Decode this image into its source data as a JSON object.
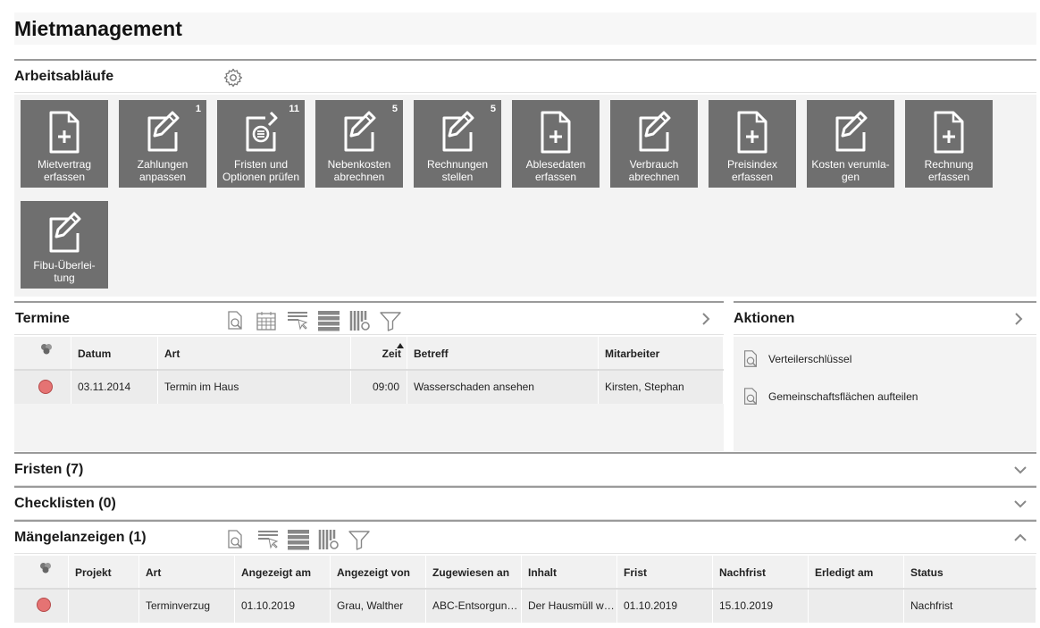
{
  "page": {
    "title": "Mietmanagement"
  },
  "workflows": {
    "title": "Arbeitsabläufe",
    "tiles": [
      {
        "label1": "Mietvertrag",
        "label2": "erfassen",
        "badge": "",
        "icon": "doc-plus-icon"
      },
      {
        "label1": "Zahlungen",
        "label2": "anpassen",
        "badge": "1",
        "icon": "edit-icon"
      },
      {
        "label1": "Fristen und",
        "label2": "Optionen prüfen",
        "badge": "11",
        "icon": "edit-list-icon"
      },
      {
        "label1": "Nebenkosten",
        "label2": "abrechnen",
        "badge": "5",
        "icon": "edit-icon"
      },
      {
        "label1": "Rechnungen",
        "label2": "stellen",
        "badge": "5",
        "icon": "edit-icon"
      },
      {
        "label1": "Ablesedaten",
        "label2": "erfassen",
        "badge": "",
        "icon": "doc-plus-icon"
      },
      {
        "label1": "Verbrauch",
        "label2": "abrechnen",
        "badge": "",
        "icon": "edit-icon"
      },
      {
        "label1": "Preisindex",
        "label2": "erfassen",
        "badge": "",
        "icon": "doc-plus-icon"
      },
      {
        "label1": "Kosten verumla-",
        "label2": "gen",
        "badge": "",
        "icon": "edit-icon"
      },
      {
        "label1": "Rechnung",
        "label2": "erfassen",
        "badge": "",
        "icon": "doc-plus-icon"
      },
      {
        "label1": "Fibu-Überlei-",
        "label2": "tung",
        "badge": "",
        "icon": "edit-icon"
      }
    ]
  },
  "termine": {
    "title": "Termine",
    "columns": [
      "Datum",
      "Art",
      "Zeit",
      "Betreff",
      "Mitarbeiter"
    ],
    "rows": [
      {
        "datum": "03.11.2014",
        "art": "Termin im Haus",
        "zeit": "09:00",
        "betreff": "Wasserschaden ansehen",
        "mitarbeiter": "Kirsten, Stephan"
      }
    ]
  },
  "aktionen": {
    "title": "Aktionen",
    "items": [
      "Verteilerschlüssel",
      "Gemeinschaftsflächen aufteilen"
    ]
  },
  "fristen": {
    "title": "Fristen (7)"
  },
  "checklisten": {
    "title": "Checklisten (0)"
  },
  "maengel": {
    "title": "Mängelanzeigen (1)",
    "columns": [
      "Projekt",
      "Art",
      "Angezeigt am",
      "Angezeigt von",
      "Zugewiesen an",
      "Inhalt",
      "Frist",
      "Nachfrist",
      "Erledigt am",
      "Status"
    ],
    "rows": [
      {
        "projekt": "",
        "art": "Terminverzug",
        "angezeigt_am": "01.10.2019",
        "angezeigt_von": "Grau, Walther",
        "zugewiesen_an": "ABC-Entsorgungs GmbH",
        "inhalt": "Der Hausmüll wurde nicht abgeholt",
        "frist": "01.10.2019",
        "nachfrist": "15.10.2019",
        "erledigt_am": "",
        "status": "Nachfrist"
      }
    ]
  },
  "colors": {
    "tile_bg": "#6f6f6f",
    "status_red": "#e57373",
    "panel_bg": "#f3f3f3"
  }
}
